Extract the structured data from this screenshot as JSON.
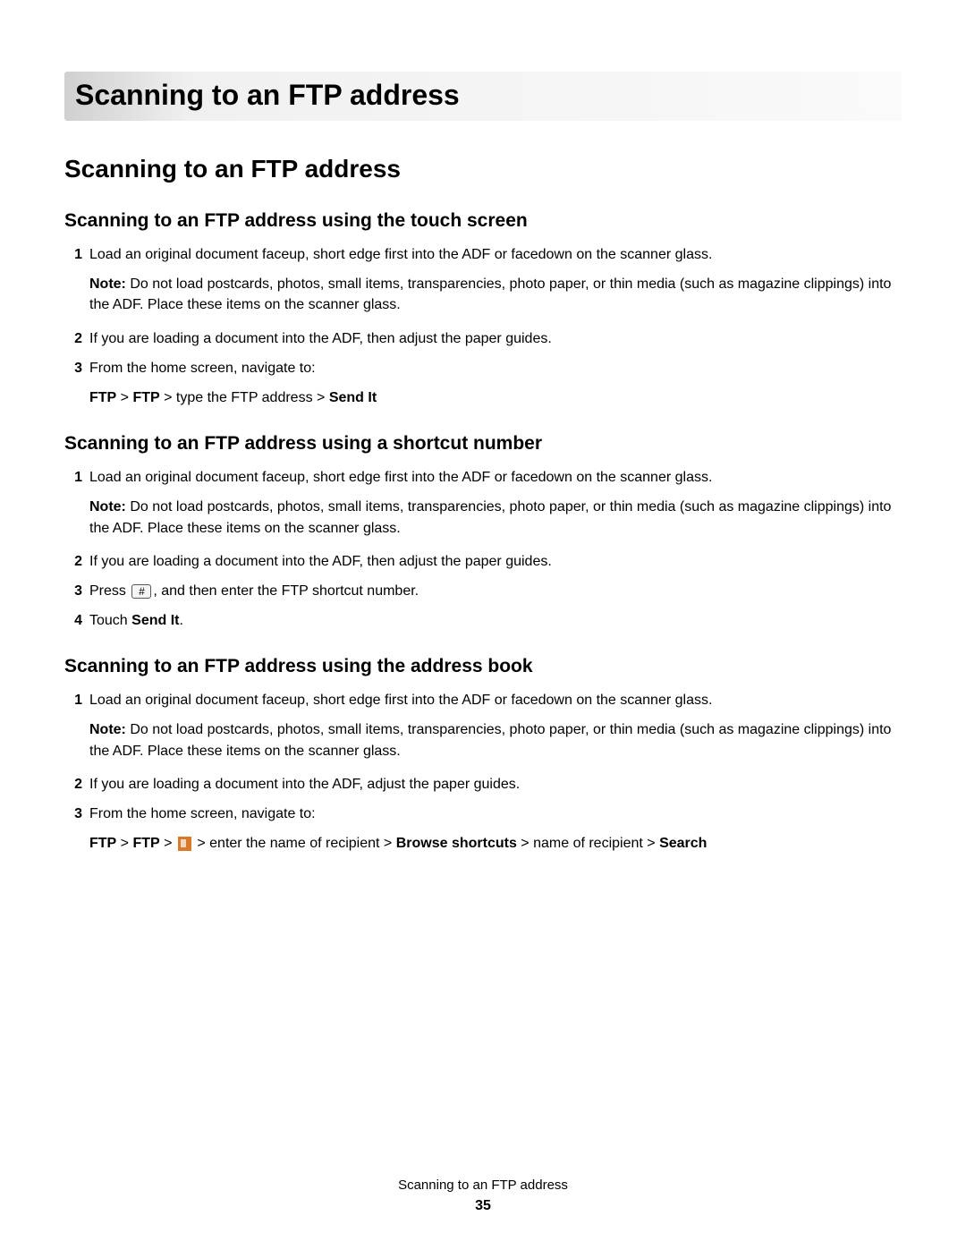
{
  "title": "Scanning to an FTP address",
  "h2": "Scanning to an FTP address",
  "section1": {
    "heading": "Scanning to an FTP address using the touch screen",
    "step1_num": "1",
    "step1_text": "Load an original document faceup, short edge first into the ADF or facedown on the scanner glass.",
    "note_label": "Note:",
    "note_text": " Do not load postcards, photos, small items, transparencies, photo paper, or thin media (such as magazine clippings) into the ADF. Place these items on the scanner glass.",
    "step2_num": "2",
    "step2_text": "If you are loading a document into the ADF, then adjust the paper guides.",
    "step3_num": "3",
    "step3_text": "From the home screen, navigate to:",
    "path_ftp1": "FTP",
    "path_sep1": " > ",
    "path_ftp2": "FTP",
    "path_mid": " > type the FTP address > ",
    "path_send": "Send It"
  },
  "section2": {
    "heading": "Scanning to an FTP address using a shortcut number",
    "step1_num": "1",
    "step1_text": "Load an original document faceup, short edge first into the ADF or facedown on the scanner glass.",
    "note_label": "Note:",
    "note_text": " Do not load postcards, photos, small items, transparencies, photo paper, or thin media (such as magazine clippings) into the ADF. Place these items on the scanner glass.",
    "step2_num": "2",
    "step2_text": "If you are loading a document into the ADF, then adjust the paper guides.",
    "step3_num": "3",
    "step3_pre": "Press ",
    "hash": "#",
    "step3_post": ", and then enter the FTP shortcut number.",
    "step4_num": "4",
    "step4_pre": "Touch ",
    "step4_bold": "Send It",
    "step4_post": "."
  },
  "section3": {
    "heading": "Scanning to an FTP address using the address book",
    "step1_num": "1",
    "step1_text": "Load an original document faceup, short edge first into the ADF or facedown on the scanner glass.",
    "note_label": "Note:",
    "note_text": " Do not load postcards, photos, small items, transparencies, photo paper, or thin media (such as magazine clippings) into the ADF. Place these items on the scanner glass.",
    "step2_num": "2",
    "step2_text": "If you are loading a document into the ADF, adjust the paper guides.",
    "step3_num": "3",
    "step3_text": "From the home screen, navigate to:",
    "path_ftp1": "FTP",
    "path_sep1": " > ",
    "path_ftp2": "FTP",
    "path_sep2": " > ",
    "path_mid1": " > enter the name of recipient > ",
    "path_browse": "Browse shortcuts",
    "path_mid2": " > name of recipient > ",
    "path_search": "Search"
  },
  "footer": {
    "title": "Scanning to an FTP address",
    "page": "35"
  }
}
